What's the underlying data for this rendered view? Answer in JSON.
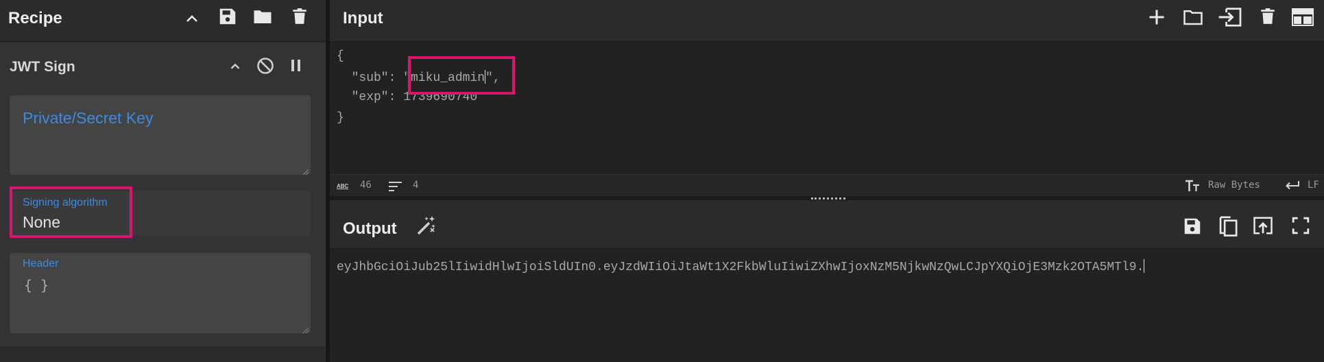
{
  "recipe": {
    "title": "Recipe",
    "icons": [
      "chevron-up-icon",
      "save-icon",
      "folder-icon",
      "trash-icon"
    ],
    "operation": {
      "name": "JWT Sign",
      "icons": [
        "chevron-up-icon",
        "disable-icon",
        "pause-icon"
      ],
      "key_placeholder": "Private/Secret Key",
      "algorithm_label": "Signing algorithm",
      "algorithm_value": "None",
      "header_label": "Header",
      "header_value": "{ }"
    }
  },
  "input": {
    "title": "Input",
    "icons": [
      "plus-icon",
      "folder-icon",
      "import-icon",
      "trash-icon",
      "layout-icon"
    ],
    "lines": [
      "{",
      "  \"sub\": \"miku_admin",
      "\",",
      "  \"exp\": 1739690740",
      "}"
    ],
    "status": {
      "char_count": "46",
      "line_count": "4",
      "encoding": "Raw Bytes",
      "eol": "LF"
    }
  },
  "output": {
    "title": "Output",
    "icons": [
      "magic-wand-icon",
      "save-icon",
      "copy-icon",
      "replace-input-icon",
      "maximize-icon"
    ],
    "text": "eyJhbGciOiJub25lIiwidHlwIjoiSldUIn0.eyJzdWIiOiJtaWt1X2FkbWluIiwiZXhwIjoxNzM5NjkwNzQwLCJpYXQiOjE3Mzk2OTA5MTl9."
  },
  "colors": {
    "highlight": "#d8166e",
    "accent_blue": "#3e8ae0",
    "panel_bg": "#2b2b2b",
    "editor_bg": "#222222"
  }
}
